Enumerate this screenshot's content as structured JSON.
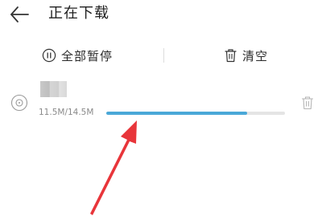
{
  "header": {
    "title": "正在下载",
    "back_icon": "arrow-left-icon"
  },
  "actions": {
    "pause_all_label": "全部暂停",
    "pause_icon": "pause-circle-icon",
    "clear_label": "清空",
    "clear_icon": "trash-icon"
  },
  "download": {
    "size_text": "11.5M/14.5M",
    "progress": 0.79,
    "progress_color": "#4aa8d8",
    "item_icon": "disc-icon",
    "delete_icon": "trash-icon"
  },
  "annotation": {
    "color": "#e8353a"
  }
}
